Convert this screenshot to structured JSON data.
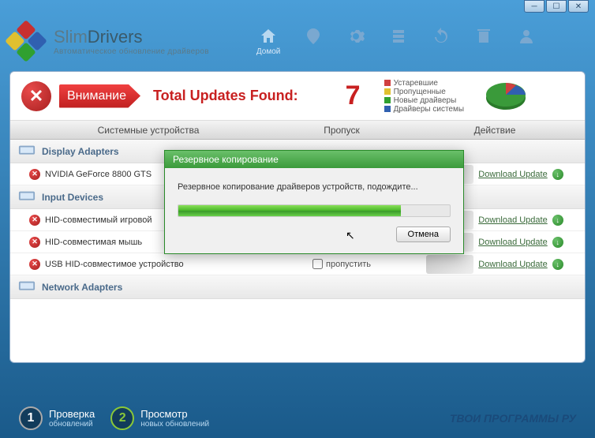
{
  "brand": {
    "name_a": "Slim",
    "name_b": "Drivers",
    "subtitle": "Автоматическое обновление драйверов"
  },
  "nav": {
    "home": "Домой"
  },
  "alert": {
    "badge": "Внимание",
    "title": "Total Updates Found:",
    "count": "7"
  },
  "legend": {
    "outdated": "Устаревшие",
    "missed": "Пропущенные",
    "new": "Новые драйверы",
    "system": "Драйверы системы",
    "colors": {
      "outdated": "#d04040",
      "missed": "#e0c030",
      "new": "#30a030",
      "system": "#3060b0"
    }
  },
  "columns": {
    "device": "Системные устройства",
    "skip": "Пропуск",
    "action": "Действие"
  },
  "skip_label": "пропустить",
  "download_label": "Download Update",
  "categories": [
    {
      "name": "Display Adapters",
      "devices": [
        {
          "name": "NVIDIA GeForce 8800 GTS"
        }
      ]
    },
    {
      "name": "Input Devices",
      "devices": [
        {
          "name": "HID-совместимый игровой"
        },
        {
          "name": "HID-совместимая мышь"
        },
        {
          "name": "USB HID-совместимое устройство"
        }
      ]
    },
    {
      "name": "Network Adapters",
      "devices": []
    }
  ],
  "dialog": {
    "title": "Резервное копирование",
    "message": "Резервное копирование драйверов устройств, подождите...",
    "cancel": "Отмена"
  },
  "steps": {
    "s1_title": "Проверка",
    "s1_sub": "обновлений",
    "s2_title": "Просмотр",
    "s2_sub": "новых обновлений"
  },
  "watermark": "ТВОИ ПРОГРАММЫ РУ"
}
